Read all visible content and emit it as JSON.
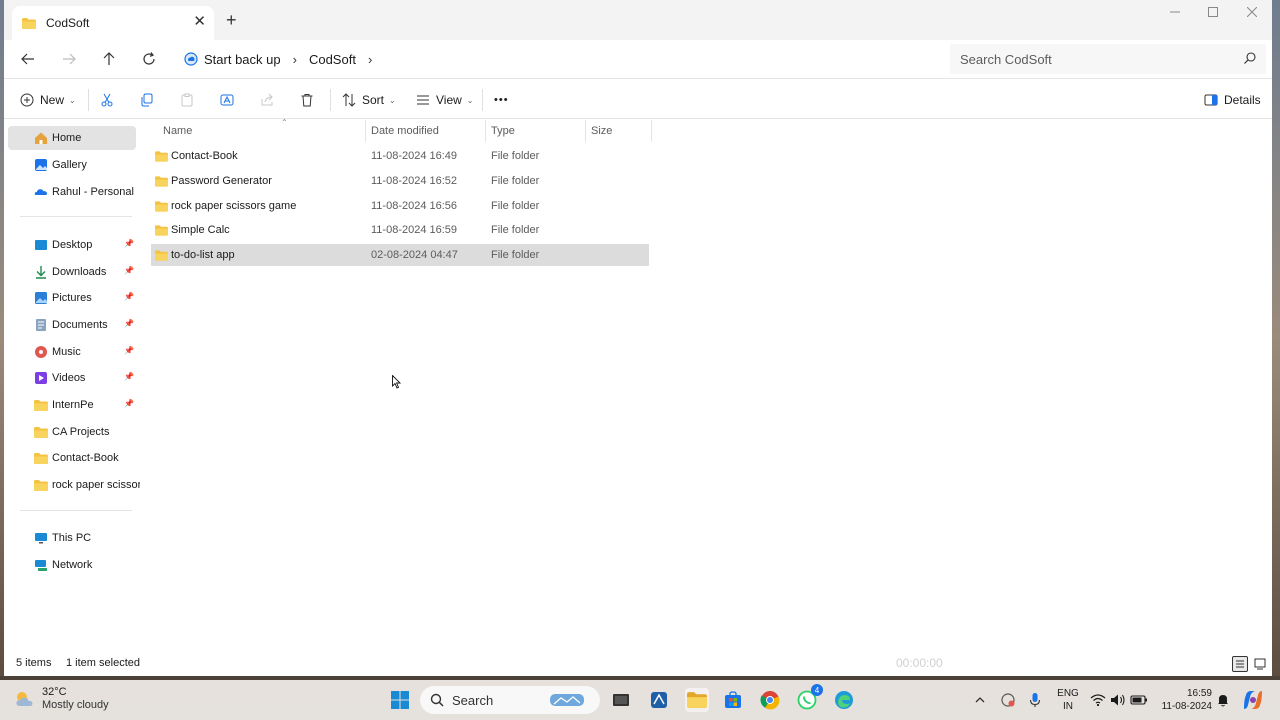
{
  "window": {
    "tab_title": "CodSoft",
    "new_tab": "+",
    "close_tab": "✕"
  },
  "address": {
    "crumbs": [
      "Start back up",
      "CodSoft"
    ],
    "search_placeholder": "Search CodSoft"
  },
  "toolbar": {
    "new_label": "New",
    "sort_label": "Sort",
    "view_label": "View",
    "more_label": "•••",
    "details_label": "Details"
  },
  "sidebar": {
    "top": [
      {
        "label": "Home",
        "icon": "home-icon",
        "selected": true
      },
      {
        "label": "Gallery",
        "icon": "gallery-icon"
      },
      {
        "label": "Rahul - Personal",
        "icon": "onedrive-icon",
        "expandable": true
      }
    ],
    "quick": [
      {
        "label": "Desktop",
        "icon": "desktop-icon",
        "pinned": true
      },
      {
        "label": "Downloads",
        "icon": "download-icon",
        "pinned": true
      },
      {
        "label": "Pictures",
        "icon": "pictures-icon",
        "pinned": true
      },
      {
        "label": "Documents",
        "icon": "documents-icon",
        "pinned": true
      },
      {
        "label": "Music",
        "icon": "music-icon",
        "pinned": true
      },
      {
        "label": "Videos",
        "icon": "videos-icon",
        "pinned": true
      },
      {
        "label": "InternPe",
        "icon": "folder-icon",
        "pinned": true
      },
      {
        "label": "CA Projects",
        "icon": "folder-icon"
      },
      {
        "label": "Contact-Book",
        "icon": "folder-icon"
      },
      {
        "label": "rock paper scissors",
        "icon": "folder-icon"
      }
    ],
    "bottom": [
      {
        "label": "This PC",
        "icon": "pc-icon",
        "expandable": true
      },
      {
        "label": "Network",
        "icon": "network-icon",
        "expandable": true
      }
    ]
  },
  "columns": {
    "name": "Name",
    "date": "Date modified",
    "type": "Type",
    "size": "Size"
  },
  "files": [
    {
      "name": "Contact-Book",
      "date": "11-08-2024 16:49",
      "type": "File folder"
    },
    {
      "name": "Password Generator",
      "date": "11-08-2024 16:52",
      "type": "File folder"
    },
    {
      "name": "rock paper scissors game",
      "date": "11-08-2024 16:56",
      "type": "File folder"
    },
    {
      "name": "Simple Calc",
      "date": "11-08-2024 16:59",
      "type": "File folder"
    },
    {
      "name": "to-do-list app",
      "date": "02-08-2024 04:47",
      "type": "File folder",
      "selected": true
    }
  ],
  "status": {
    "items": "5 items",
    "selected": "1 item selected",
    "timer": "00:00:00"
  },
  "taskbar": {
    "temp": "32°C",
    "weather": "Mostly cloudy",
    "search_label": "Search",
    "whatsapp_badge": "4",
    "lang_top": "ENG",
    "lang_bottom": "IN",
    "time": "16:59",
    "date": "11-08-2024"
  },
  "colors": {
    "folder": "#f4c343",
    "folder_dark": "#e2a82a",
    "accent": "#1a73e8",
    "selection": "#dcdcdc"
  }
}
